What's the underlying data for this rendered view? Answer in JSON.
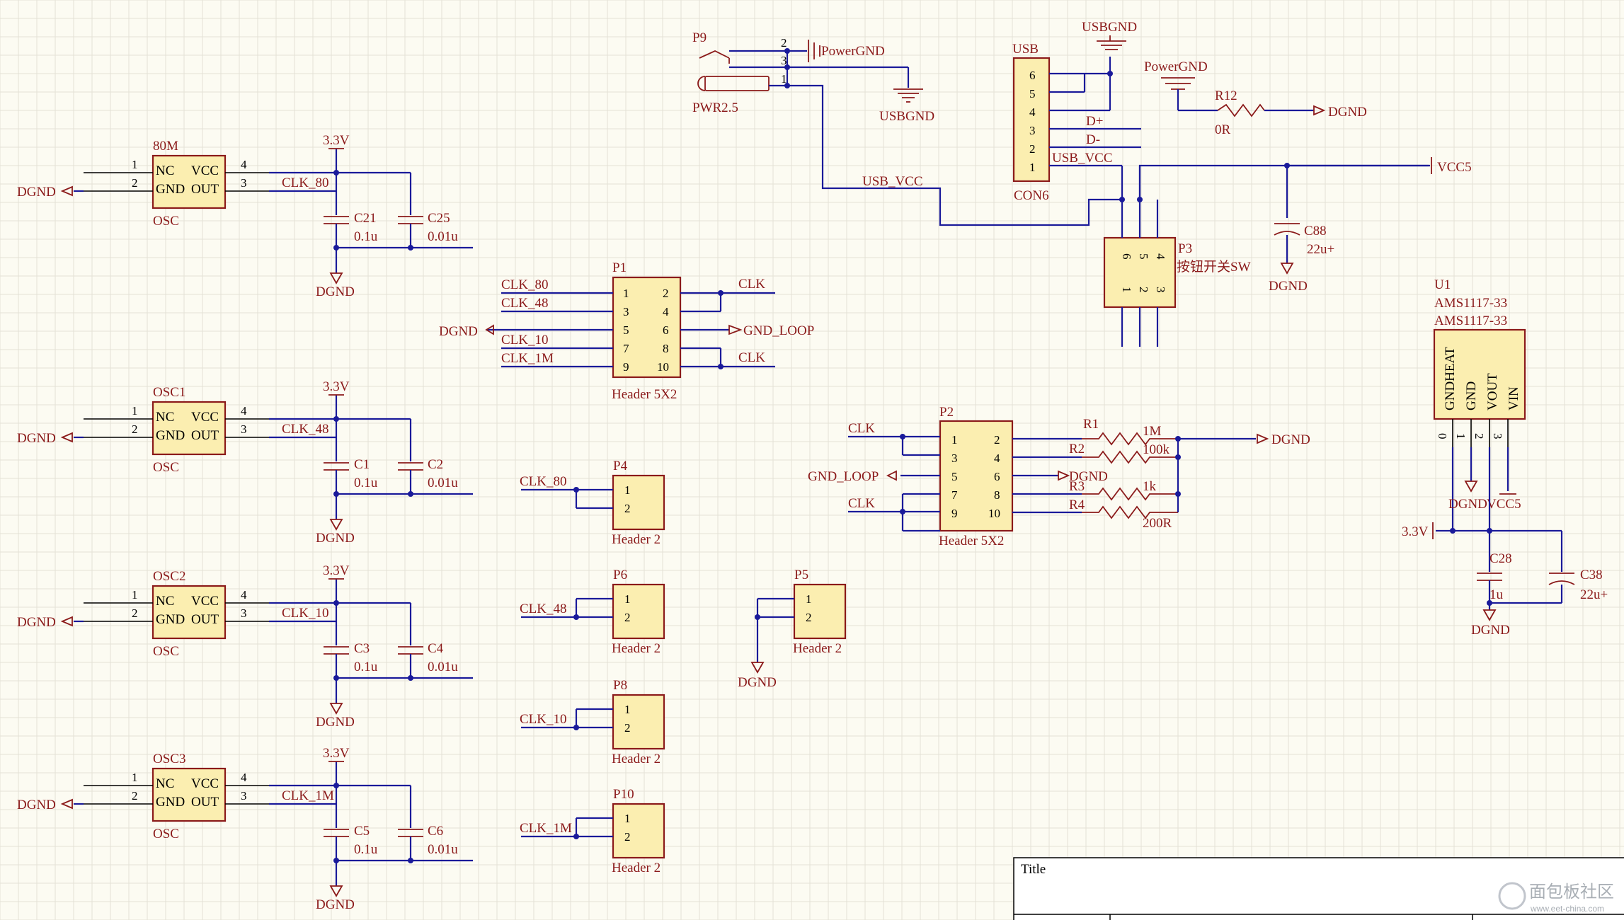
{
  "colors": {
    "wire": "#1a1a9a",
    "part": "#8b1a1a",
    "fill": "#fbeeb0",
    "background": "#fcfbf2"
  },
  "oscillators": [
    {
      "designator": "80M",
      "comment": "OSC",
      "pin_nc": "NC",
      "pin_gnd": "GND",
      "pin_vcc": "VCC",
      "pin_out": "OUT",
      "net_out": "CLK_80",
      "net_gnd": "DGND",
      "power": "3.3V",
      "ground": "DGND",
      "cap1": "C21",
      "cap1_val": "0.1u",
      "cap2": "C25",
      "cap2_val": "0.01u"
    },
    {
      "designator": "OSC1",
      "comment": "OSC",
      "pin_nc": "NC",
      "pin_gnd": "GND",
      "pin_vcc": "VCC",
      "pin_out": "OUT",
      "net_out": "CLK_48",
      "net_gnd": "DGND",
      "power": "3.3V",
      "ground": "DGND",
      "cap1": "C1",
      "cap1_val": "0.1u",
      "cap2": "C2",
      "cap2_val": "0.01u"
    },
    {
      "designator": "OSC2",
      "comment": "OSC",
      "pin_nc": "NC",
      "pin_gnd": "GND",
      "pin_vcc": "VCC",
      "pin_out": "OUT",
      "net_out": "CLK_10",
      "net_gnd": "DGND",
      "power": "3.3V",
      "ground": "DGND",
      "cap1": "C3",
      "cap1_val": "0.1u",
      "cap2": "C4",
      "cap2_val": "0.01u"
    },
    {
      "designator": "OSC3",
      "comment": "OSC",
      "pin_nc": "NC",
      "pin_gnd": "GND",
      "pin_vcc": "VCC",
      "pin_out": "OUT",
      "net_out": "CLK_1M",
      "net_gnd": "DGND",
      "power": "3.3V",
      "ground": "DGND",
      "cap1": "C5",
      "cap1_val": "0.1u",
      "cap2": "C6",
      "cap2_val": "0.01u"
    }
  ],
  "pin_numbers": {
    "p1": "1",
    "p2": "2",
    "p3": "3",
    "p4": "4",
    "p5": "5",
    "p6": "6",
    "p7": "7",
    "p8": "8",
    "p9": "9",
    "p10": "10",
    "p0": "0"
  },
  "p1": {
    "designator": "P1",
    "comment": "Header 5X2",
    "net_clk80": "CLK_80",
    "net_clk48": "CLK_48",
    "net_dgnd": "DGND",
    "net_clk10": "CLK_10",
    "net_clk1m": "CLK_1M",
    "net_clk_a": "CLK",
    "net_gndloop": "GND_LOOP",
    "net_clk_b": "CLK"
  },
  "headers2": [
    {
      "designator": "P4",
      "comment": "Header 2",
      "net": "CLK_80"
    },
    {
      "designator": "P6",
      "comment": "Header 2",
      "net": "CLK_48"
    },
    {
      "designator": "P8",
      "comment": "Header 2",
      "net": "CLK_10"
    },
    {
      "designator": "P10",
      "comment": "Header 2",
      "net": "CLK_1M"
    },
    {
      "designator": "P5",
      "comment": "Header 2",
      "net": "DGND"
    }
  ],
  "p2": {
    "designator": "P2",
    "comment": "Header 5X2",
    "net_clk_a": "CLK",
    "net_gndloop": "GND_LOOP",
    "net_clk_b": "CLK",
    "net_dgnd_mid": "DGND",
    "net_dgnd_out": "DGND"
  },
  "resistors": [
    {
      "designator": "R1",
      "value": "1M"
    },
    {
      "designator": "R2",
      "value": "100k"
    },
    {
      "designator": "R3",
      "value": "1k"
    },
    {
      "designator": "R4",
      "value": "200R"
    },
    {
      "designator": "R12",
      "value": "0R"
    }
  ],
  "power_jack": {
    "designator": "P9",
    "comment": "PWR2.5",
    "net_powergnd": "PowerGND",
    "net_usbgnd": "USBGND"
  },
  "usb": {
    "designator": "USB",
    "comment": "CON6",
    "net_usbgnd": "USBGND",
    "net_dp": "D+",
    "net_dm": "D-",
    "net_vcc_pin": "USB_VCC",
    "net_vcc_wire": "USB_VCC"
  },
  "powergnd_r": {
    "net_powergnd": "PowerGND",
    "net_dgnd": "DGND"
  },
  "switch": {
    "designator": "P3",
    "comment": "按钮开关SW"
  },
  "vcc5": {
    "net": "VCC5",
    "cap": "C88",
    "cap_val": "22u+",
    "ground": "DGND"
  },
  "regulator": {
    "designator": "U1",
    "comment": "AMS1117-33",
    "comment2": "AMS1117-33",
    "pin_labels": [
      "GNDHEAT",
      "GND",
      "VOUT",
      "VIN"
    ],
    "net_dgnd": "DGND",
    "net_vcc5": "VCC5",
    "net_33": "3.3V",
    "cap1": "C28",
    "cap1_val": "1u",
    "cap2": "C38",
    "cap2_val": "22u+",
    "ground": "DGND"
  },
  "title_block": {
    "title": "Title"
  },
  "watermark": {
    "text": "面包板社区",
    "sub": "www.eet-china.com"
  }
}
